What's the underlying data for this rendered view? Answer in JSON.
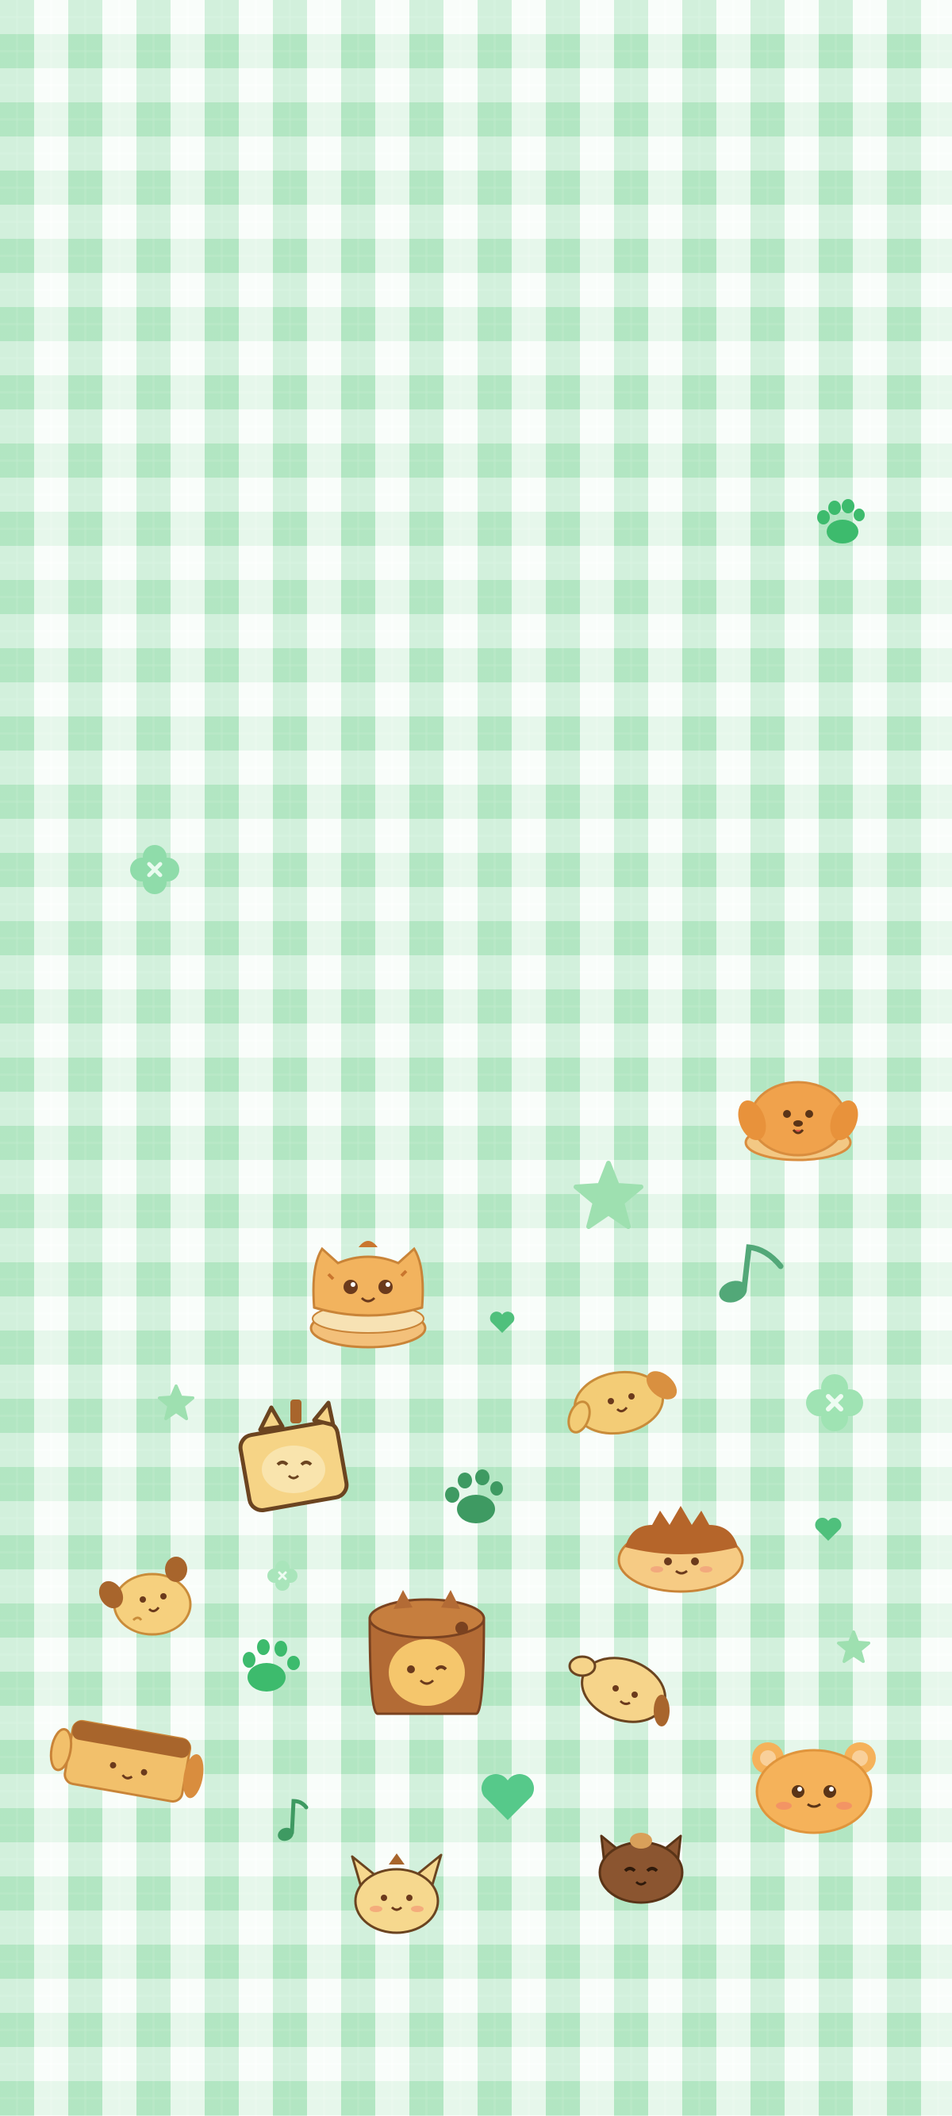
{
  "wallpaper": {
    "pattern": "gingham",
    "colors": {
      "base": "#e2f7e7",
      "check": "#a8e6bb",
      "light": "#f4fdf6"
    },
    "stickers": [
      {
        "name": "paw-icon",
        "color": "#3dbb6d"
      },
      {
        "name": "clover-icon",
        "color": "#8fdcaa"
      },
      {
        "name": "dog-bun-pastry-icon",
        "color": "#f0a24c"
      },
      {
        "name": "star-icon",
        "color": "#9ee0b0"
      },
      {
        "name": "music-note-icon",
        "color": "#52a878"
      },
      {
        "name": "cat-macaron-icon",
        "color": "#f2b35e"
      },
      {
        "name": "heart-icon",
        "color": "#4fc07c"
      },
      {
        "name": "dog-croissant-icon",
        "color": "#f3cc76"
      },
      {
        "name": "cat-toast-box-icon",
        "color": "#f6d486"
      },
      {
        "name": "cream-bun-icon",
        "color": "#f2bb6a"
      },
      {
        "name": "puppy-cookie-icon",
        "color": "#f6d07e"
      },
      {
        "name": "cat-cake-roll-icon",
        "color": "#b36b35"
      },
      {
        "name": "dog-castella-icon",
        "color": "#f2c06b"
      },
      {
        "name": "bear-bun-icon",
        "color": "#f5b25a"
      },
      {
        "name": "fox-cookie-icon",
        "color": "#f6d88e"
      },
      {
        "name": "chocolate-cat-icon",
        "color": "#8b5530"
      }
    ]
  }
}
